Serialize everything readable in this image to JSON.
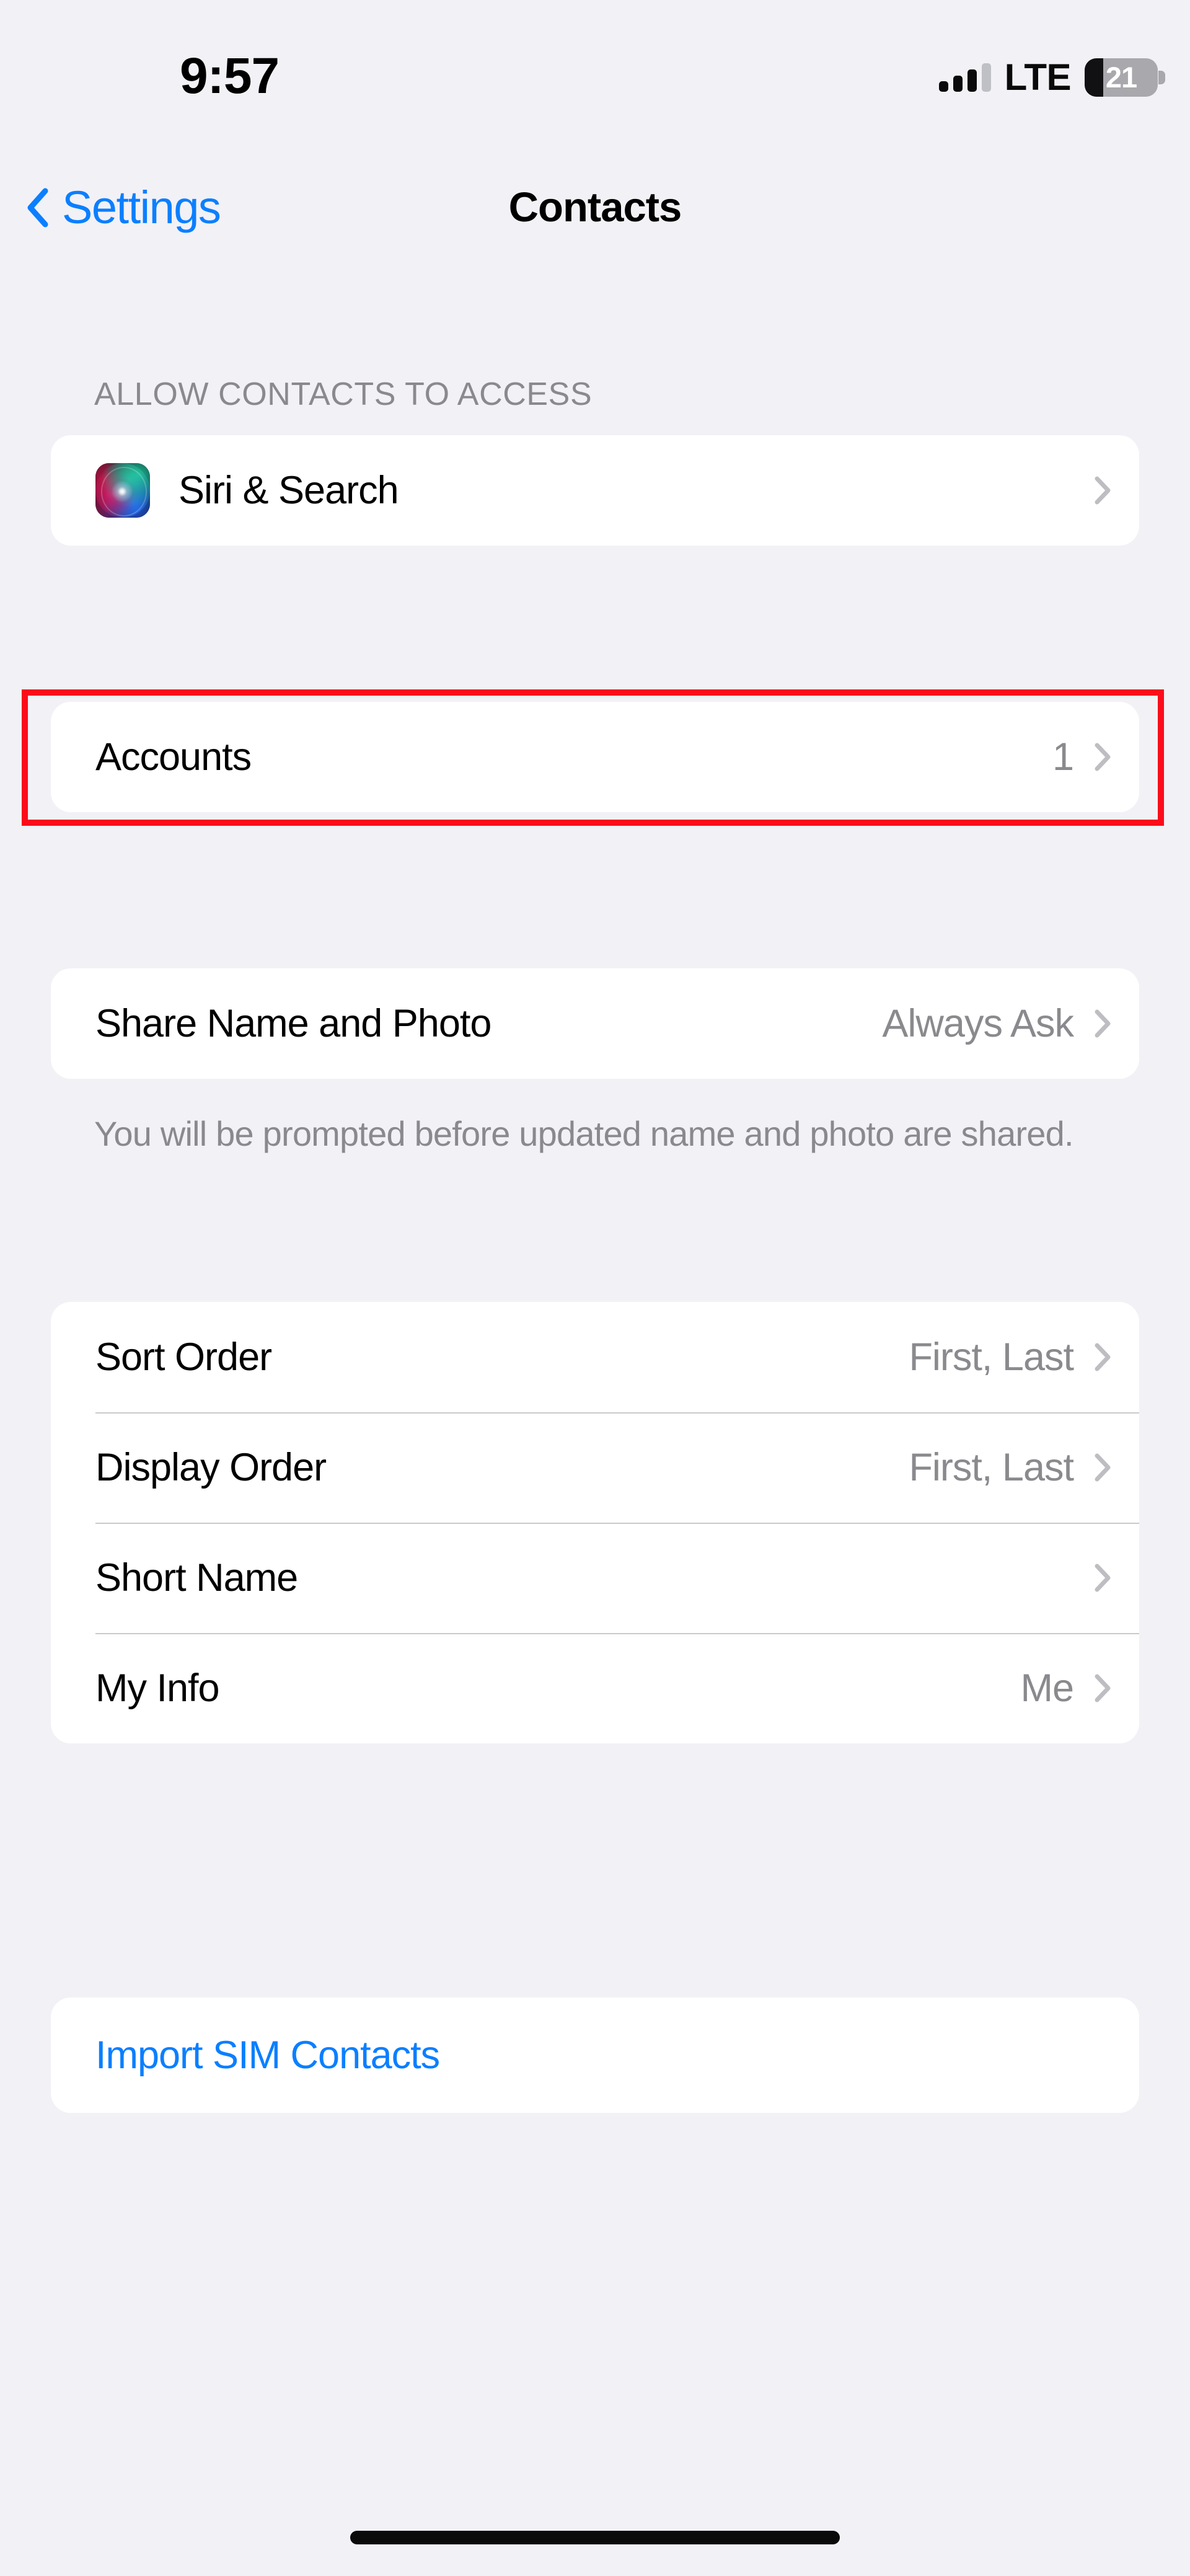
{
  "status_bar": {
    "time": "9:57",
    "network_label": "LTE",
    "battery_percent": "21",
    "battery_level": 25,
    "signal_bars_filled": 3,
    "signal_bars_total": 4
  },
  "nav_bar": {
    "back_label": "Settings",
    "title": "Contacts"
  },
  "sections": [
    {
      "header": "ALLOW CONTACTS TO ACCESS",
      "rows": [
        {
          "label": "Siri & Search",
          "value": "",
          "icon": "siri-icon",
          "chevron": true
        }
      ]
    },
    {
      "header": "",
      "rows": [
        {
          "label": "Accounts",
          "value": "1",
          "icon": "",
          "chevron": true,
          "highlighted": true
        }
      ]
    },
    {
      "header": "",
      "rows": [
        {
          "label": "Share Name and Photo",
          "value": "Always Ask",
          "icon": "",
          "chevron": true
        }
      ],
      "footer": "You will be prompted before updated name and photo are shared."
    },
    {
      "header": "",
      "rows": [
        {
          "label": "Sort Order",
          "value": "First, Last",
          "icon": "",
          "chevron": true
        },
        {
          "label": "Display Order",
          "value": "First, Last",
          "icon": "",
          "chevron": true
        },
        {
          "label": "Short Name",
          "value": "",
          "icon": "",
          "chevron": true
        },
        {
          "label": "My Info",
          "value": "Me",
          "icon": "",
          "chevron": true
        }
      ]
    },
    {
      "header": "",
      "rows": [
        {
          "label": "Import SIM Contacts",
          "value": "",
          "icon": "",
          "chevron": false,
          "is_link": true
        }
      ]
    }
  ],
  "colors": {
    "background": "#F2F1F6",
    "card": "#FFFFFF",
    "accent_blue": "#0B7FFF",
    "secondary_text": "#8A8A8E",
    "primary_text": "#000000",
    "separator": "#C9C9CE",
    "annotation_red": "#FC0D1B"
  }
}
